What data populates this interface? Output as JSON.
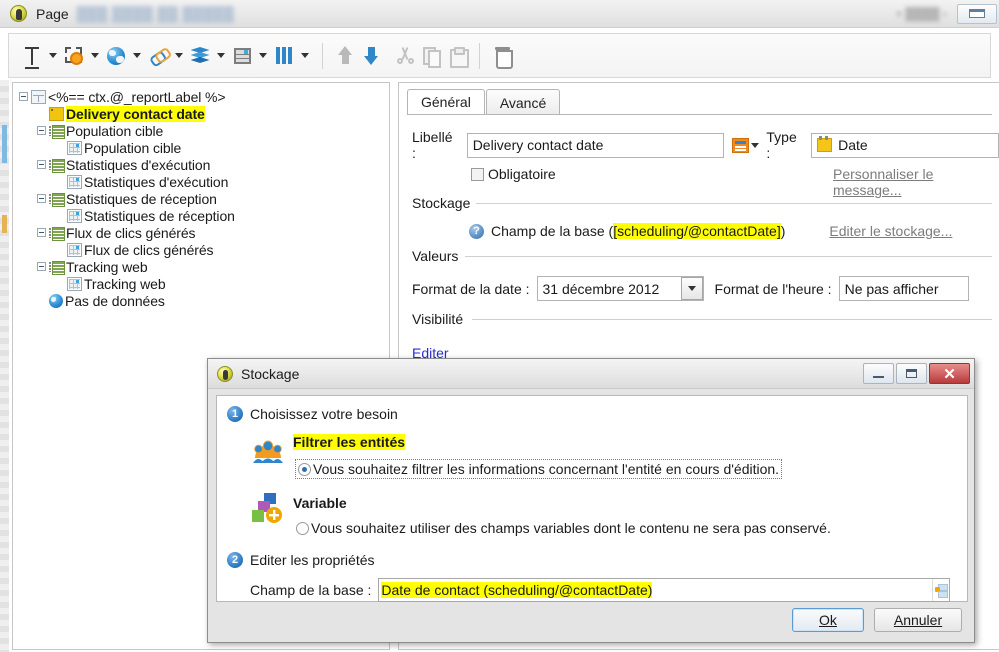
{
  "window": {
    "title": "Page",
    "ghost_title": "Blurred page name",
    "restore_button": "restore-window"
  },
  "toolbar": {
    "items": [
      {
        "name": "insert-text-field",
        "icon": "text-field-icon",
        "has_caret": true,
        "enabled": true
      },
      {
        "name": "insert-form-field",
        "icon": "form-field-icon",
        "has_caret": true,
        "enabled": true
      },
      {
        "name": "insert-web-element",
        "icon": "globe-icon",
        "has_caret": true,
        "enabled": true
      },
      {
        "name": "insert-link",
        "icon": "link-icon",
        "has_caret": true,
        "enabled": true
      },
      {
        "name": "insert-container",
        "icon": "layers-icon",
        "has_caret": true,
        "enabled": true
      },
      {
        "name": "insert-table",
        "icon": "table-icon",
        "has_caret": true,
        "enabled": true
      },
      {
        "name": "insert-columns",
        "icon": "columns-icon",
        "has_caret": true,
        "enabled": true
      },
      {
        "name": "move-up",
        "icon": "arrow-up-icon",
        "has_caret": false,
        "enabled": false
      },
      {
        "name": "move-down",
        "icon": "arrow-down-icon",
        "has_caret": false,
        "enabled": true
      },
      {
        "name": "cut",
        "icon": "scissors-icon",
        "has_caret": false,
        "enabled": false
      },
      {
        "name": "copy",
        "icon": "copy-icon",
        "has_caret": false,
        "enabled": false
      },
      {
        "name": "paste",
        "icon": "paste-icon",
        "has_caret": false,
        "enabled": false
      },
      {
        "name": "delete",
        "icon": "trash-icon",
        "has_caret": false,
        "enabled": true
      }
    ]
  },
  "tree": {
    "nodes": [
      {
        "label": "<%== ctx.@_reportLabel %>",
        "depth": 0,
        "icon": "page-icon",
        "expander": "minus",
        "highlight": false
      },
      {
        "label": "Delivery contact date",
        "depth": 1,
        "icon": "field-icon",
        "expander": "none",
        "highlight": true
      },
      {
        "label": "Population cible",
        "depth": 1,
        "icon": "list-icon",
        "expander": "minus",
        "highlight": false
      },
      {
        "label": "Population cible",
        "depth": 2,
        "icon": "grid-icon",
        "expander": "none",
        "highlight": false
      },
      {
        "label": "Statistiques d'exécution",
        "depth": 1,
        "icon": "list-icon",
        "expander": "minus",
        "highlight": false
      },
      {
        "label": "Statistiques d'exécution",
        "depth": 2,
        "icon": "grid-icon",
        "expander": "none",
        "highlight": false
      },
      {
        "label": "Statistiques de réception",
        "depth": 1,
        "icon": "list-icon",
        "expander": "minus",
        "highlight": false
      },
      {
        "label": "Statistiques de réception",
        "depth": 2,
        "icon": "grid-icon",
        "expander": "none",
        "highlight": false
      },
      {
        "label": "Flux de clics générés",
        "depth": 1,
        "icon": "list-icon",
        "expander": "minus",
        "highlight": false
      },
      {
        "label": "Flux de clics générés",
        "depth": 2,
        "icon": "grid-icon",
        "expander": "none",
        "highlight": false
      },
      {
        "label": "Tracking web",
        "depth": 1,
        "icon": "list-icon",
        "expander": "minus",
        "highlight": false
      },
      {
        "label": "Tracking web",
        "depth": 2,
        "icon": "grid-icon",
        "expander": "none",
        "highlight": false
      },
      {
        "label": "Pas de données",
        "depth": 1,
        "icon": "globe-icon",
        "expander": "none",
        "highlight": false
      }
    ]
  },
  "form": {
    "tabs": [
      {
        "label": "Général",
        "active": true
      },
      {
        "label": "Avancé",
        "active": false
      }
    ],
    "label_caption": "Libellé :",
    "label_value": "Delivery contact date",
    "type_caption": "Type :",
    "type_value": "Date",
    "mandatory_caption": "Obligatoire",
    "mandatory_checked": false,
    "customize_message_link": "Personnaliser le message...",
    "storage_group": "Stockage",
    "storage_text_prefix": "Champ de la base (",
    "storage_text_highlight": "[scheduling/@contactDate]",
    "storage_text_suffix": ")",
    "edit_storage_link": "Editer le stockage...",
    "values_group": "Valeurs",
    "date_format_caption": "Format de la date :",
    "date_format_value": "31 décembre 2012",
    "time_format_caption": "Format de l'heure :",
    "time_format_value": "Ne pas afficher",
    "visibility_group": "Visibilité",
    "visibility_link": "Editer"
  },
  "dialog": {
    "title": "Stockage",
    "step1_number": "1",
    "step1_title": "Choisissez votre besoin",
    "option1_heading": "Filtrer les entités",
    "option1_text": "Vous souhaitez filtrer les informations concernant l'entité en cours d'édition.",
    "option1_selected": true,
    "option2_heading": "Variable",
    "option2_text": "Vous souhaitez utiliser des champs variables dont le contenu ne sera pas conservé.",
    "option2_selected": false,
    "step2_number": "2",
    "step2_title": "Editer les propriétés",
    "field_caption": "Champ de la base :",
    "field_value": "Date de contact (scheduling/@contactDate)",
    "ok_label": "Ok",
    "cancel_label": "Annuler",
    "min_button": "minimize",
    "max_button": "maximize",
    "close_button": "✕"
  },
  "colors": {
    "highlight": "#ffff00",
    "accent_blue": "#2f86c8",
    "link_blue": "#2b2bd0",
    "close_red": "#b73b3b"
  }
}
